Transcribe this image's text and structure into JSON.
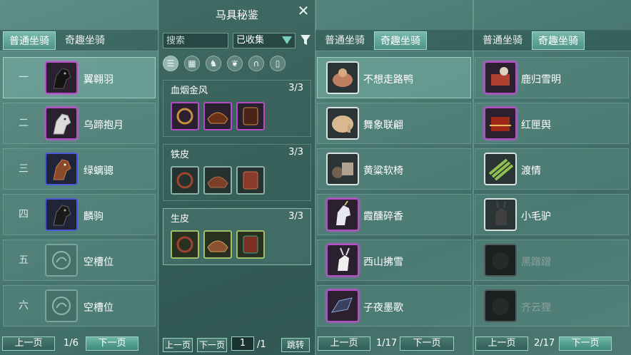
{
  "tabs": {
    "normal": "普通坐骑",
    "fun": "奇趣坐骑"
  },
  "panel1": {
    "rows": [
      {
        "num": "一",
        "name": "翼翱羽"
      },
      {
        "num": "二",
        "name": "乌蹄抱月"
      },
      {
        "num": "三",
        "name": "绿螭骢"
      },
      {
        "num": "四",
        "name": "麟驹"
      },
      {
        "num": "五",
        "name": "空槽位"
      },
      {
        "num": "六",
        "name": "空槽位"
      }
    ],
    "prev": "上一页",
    "page": "1/6",
    "next": "下一页"
  },
  "panel2": {
    "title": "马具秘鉴",
    "close": "✕",
    "search_placeholder": "搜索",
    "filter_value": "已收集",
    "groups": [
      {
        "name": "血烟金风",
        "count": "3/3"
      },
      {
        "name": "铁皮",
        "count": "3/3"
      },
      {
        "name": "生皮",
        "count": "3/3"
      }
    ],
    "prev": "上一页",
    "next": "下一页",
    "page_input": "1",
    "total": "/1",
    "jump": "跳转"
  },
  "panel3": {
    "rows": [
      "不想走路鸭",
      "舞象联翩",
      "黄粱软椅",
      "霞醺碎香",
      "西山拂雪",
      "子夜墨歌"
    ],
    "prev": "上一页",
    "page": "1/17",
    "next": "下一页"
  },
  "panel4": {
    "rows": [
      "鹿归雪明",
      "红匣舆",
      "渡情",
      "小毛驴",
      "黑蹭蹭",
      "齐云狸"
    ],
    "prev": "上一页",
    "page": "2/17",
    "next": "下一页"
  },
  "colors": {
    "purple": "#b64cc6",
    "blue": "#4a57d8",
    "accent": "#7ad0c0"
  }
}
